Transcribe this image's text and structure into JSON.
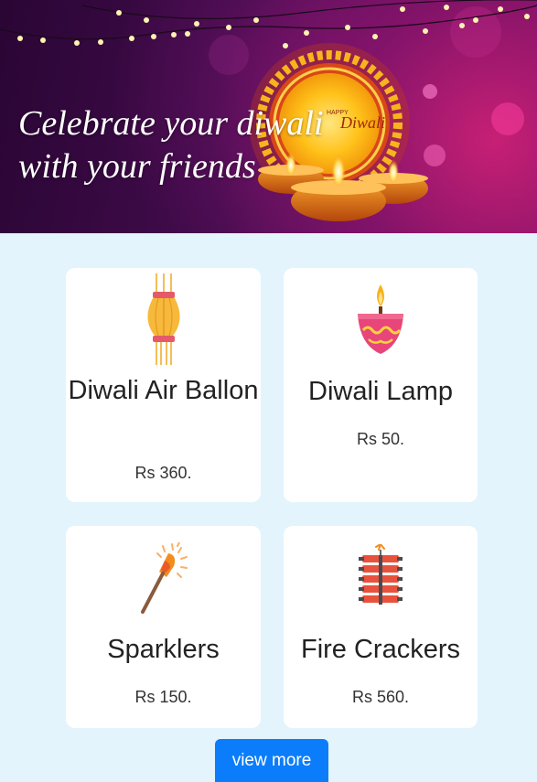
{
  "hero": {
    "title_line1": "Celebrate your diwali",
    "title_line2": "with your friends",
    "badge_small": "HAPPY",
    "badge_script": "Diwali"
  },
  "products": [
    {
      "name": "Diwali Air Ballon",
      "price": "Rs 360.",
      "icon": "sky-lantern-icon"
    },
    {
      "name": "Diwali Lamp",
      "price": "Rs 50.",
      "icon": "diya-lamp-icon"
    },
    {
      "name": "Sparklers",
      "price": "Rs 150.",
      "icon": "sparkler-icon"
    },
    {
      "name": "Fire Crackers",
      "price": "Rs 560.",
      "icon": "firecrackers-icon"
    }
  ],
  "actions": {
    "view_more": "view more"
  },
  "colors": {
    "background": "#e3f4fd",
    "button": "#0b7dfb",
    "banner": "#3d0a47"
  }
}
